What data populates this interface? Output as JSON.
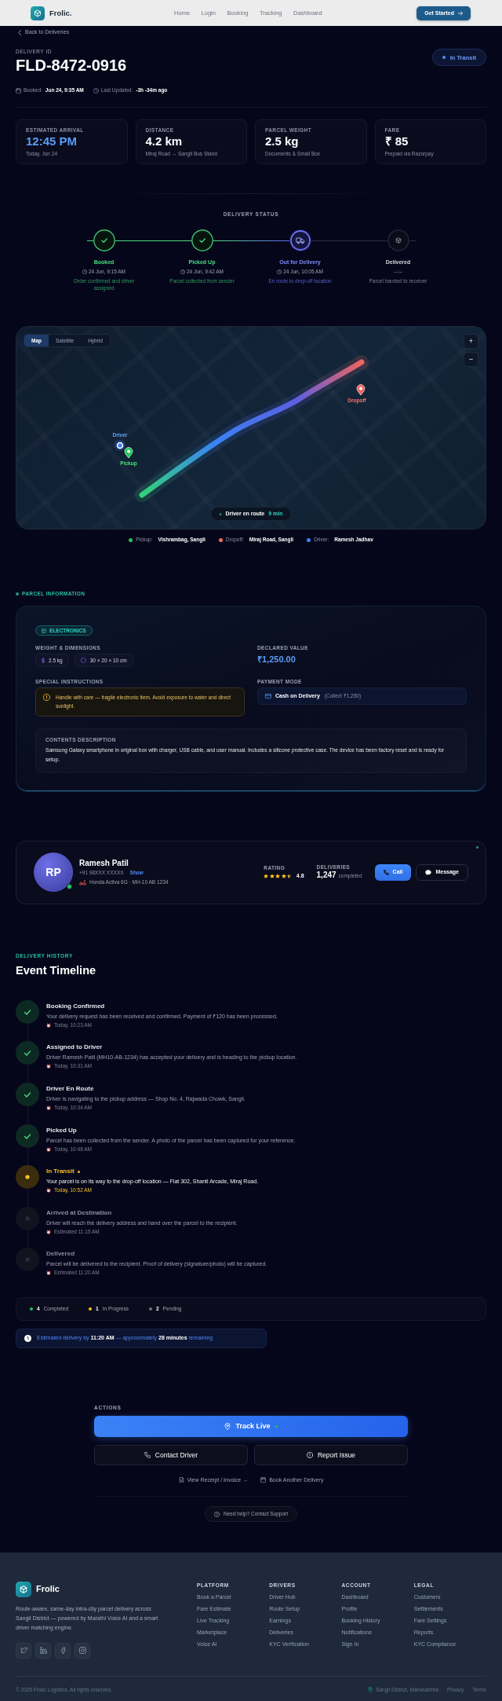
{
  "navbar": {
    "brand": "Frolic.",
    "links": [
      "Home",
      "Login",
      "Booking",
      "Tracking",
      "Dashboard"
    ],
    "cta": "Get Started"
  },
  "back_link": "Back to Deliveries",
  "header": {
    "id_label": "DELIVERY ID",
    "delivery_id": "FLD-8472-0916",
    "status": "In Transit",
    "booked_label": "Booked:",
    "booked_value": "Jun 24, 9:35 AM",
    "updated_label": "Last Updated:",
    "updated_value": "-3h -34m ago"
  },
  "stats": [
    {
      "label": "ESTIMATED ARRIVAL",
      "value": "12:45 PM",
      "detail": "Today, Jun 24",
      "highlight": true
    },
    {
      "label": "DISTANCE",
      "value": "4.2 km",
      "detail": "Miraj Road → Sangli Bus Stand",
      "highlight": false
    },
    {
      "label": "PARCEL WEIGHT",
      "value": "2.5 kg",
      "detail": "Documents & Small Box",
      "highlight": false
    },
    {
      "label": "FARE",
      "value": "₹ 85",
      "detail": "Prepaid via Razorpay",
      "highlight": false
    }
  ],
  "delivery_status": {
    "title": "DELIVERY STATUS",
    "steps": [
      {
        "label": "Booked",
        "time": "24 Jun, 9:15 AM",
        "note": "Order confirmed and driver assigned",
        "kind": "done"
      },
      {
        "label": "Picked Up",
        "time": "24 Jun, 9:42 AM",
        "note": "Parcel collected from sender",
        "kind": "done"
      },
      {
        "label": "Out for Delivery",
        "time": "24 Jun, 10:05 AM",
        "note": "En route to drop-off location",
        "kind": "current"
      },
      {
        "label": "Delivered",
        "time": "--:--",
        "note": "Parcel handed to receiver",
        "kind": "pending"
      }
    ]
  },
  "map": {
    "tabs": [
      {
        "label": "Map",
        "selected": true
      },
      {
        "label": "Satellite",
        "selected": false
      },
      {
        "label": "Hybrid",
        "selected": false
      }
    ],
    "zoom_in": "+",
    "zoom_out": "−",
    "markers": [
      {
        "kind": "driver",
        "label": "Driver"
      },
      {
        "kind": "pickup",
        "label": "Pickup"
      },
      {
        "kind": "dropoff",
        "label": "Dropoff"
      }
    ],
    "eta_label": "Driver en route",
    "eta_value": "9 min"
  },
  "legend": [
    {
      "label": "Pickup:",
      "value": "Vishrambag, Sangli",
      "color": "#22c55e"
    },
    {
      "label": "Dropoff:",
      "value": "Miraj Road, Sangli",
      "color": "#ef6b5f"
    },
    {
      "label": "Driver:",
      "value": "Ramesh Jadhav",
      "color": "#3b82f6"
    }
  ],
  "parcel": {
    "section_title": "PARCEL INFORMATION",
    "category": "ELECTRONICS",
    "weight_label": "WEIGHT & DIMENSIONS",
    "weight": "2.5 kg",
    "dimensions": "30 × 20 × 10 cm",
    "declared_label": "DECLARED VALUE",
    "declared_value": "₹1,250.00",
    "instructions_label": "SPECIAL INSTRUCTIONS",
    "instructions": "Handle with care — fragile electronic item. Avoid exposure to water and direct sunlight.",
    "payment_label": "PAYMENT MODE",
    "payment_mode": "Cash on Delivery",
    "payment_note": "(Collect ₹1,250)",
    "contents_label": "CONTENTS DESCRIPTION",
    "contents": "Samsung Galaxy smartphone in original box with charger, USB cable, and user manual. Includes a silicone protective case. The device has been factory reset and is ready for setup."
  },
  "driver": {
    "initials": "RP",
    "online": true,
    "name": "Ramesh Patil",
    "phone": "+91 98XXX XXXXX",
    "phone_action": "Show",
    "vehicle": "Honda Activa 6G · MH-10 AB 1234",
    "rating_label": "RATING",
    "stars": 4.5,
    "rating": "4.8",
    "deliveries_label": "DELIVERIES",
    "deliveries": "1,247",
    "deliveries_note": "completed",
    "call": "Call",
    "message": "Message"
  },
  "timeline": {
    "eyebrow": "DELIVERY HISTORY",
    "title": "Event Timeline",
    "events": [
      {
        "title": "Booking Confirmed",
        "description": "Your delivery request has been received and confirmed. Payment of ₹120 has been processed.",
        "time": "Today, 10:23 AM",
        "kind": "done"
      },
      {
        "title": "Assigned to Driver",
        "description": "Driver Ramesh Patil (MH10-AB-1234) has accepted your delivery and is heading to the pickup location.",
        "time": "Today, 10:31 AM",
        "kind": "done"
      },
      {
        "title": "Driver En Route",
        "description": "Driver is navigating to the pickup address — Shop No. 4, Rajwada Chowk, Sangli.",
        "time": "Today, 10:34 AM",
        "kind": "done"
      },
      {
        "title": "Picked Up",
        "description": "Parcel has been collected from the sender. A photo of the parcel has been captured for your reference.",
        "time": "Today, 10:48 AM",
        "kind": "done"
      },
      {
        "title": "In Transit",
        "description": "Your parcel is on its way to the drop-off location — Flat 302, Shanti Arcade, Miraj Road.",
        "time": "Today, 10:52 AM",
        "kind": "current"
      },
      {
        "title": "Arrived at Destination",
        "description": "Driver will reach the delivery address and hand over the parcel to the recipient.",
        "time": "Estimated 11:15 AM",
        "kind": "pending"
      },
      {
        "title": "Delivered",
        "description": "Parcel will be delivered to the recipient. Proof of delivery (signature/photo) will be captured.",
        "time": "Estimated 11:20 AM",
        "kind": "pending"
      }
    ]
  },
  "summary": [
    {
      "count": "4",
      "label": "Completed",
      "color": "#22c55e"
    },
    {
      "count": "1",
      "label": "In Progress",
      "color": "#fbbf24"
    },
    {
      "count": "2",
      "label": "Pending",
      "color": "#6b7280"
    }
  ],
  "eta_notice": "Estimated delivery by **11:20 AM** — approximately **28 minutes** remaining",
  "actions": {
    "title": "ACTIONS",
    "primary": "Track Live",
    "live": true,
    "buttons": [
      {
        "kind": "contact",
        "label": "Contact Driver"
      },
      {
        "kind": "report",
        "label": "Report Issue"
      }
    ],
    "links": [
      {
        "kind": "receipt",
        "label": "View Receipt / Invoice →"
      },
      {
        "kind": "book",
        "label": "Book Another Delivery"
      }
    ],
    "help": "Need help? Contact Support"
  },
  "footer": {
    "brand": "Frolic",
    "description": "Route-aware, same-day intra-city parcel delivery across Sangli District — powered by Marathi Voice AI and a smart driver matching engine.",
    "columns": [
      {
        "title": "PLATFORM",
        "links": [
          "Book a Parcel",
          "Fare Estimate",
          "Live Tracking",
          "Marketplace",
          "Voice AI"
        ]
      },
      {
        "title": "DRIVERS",
        "links": [
          "Driver Hub",
          "Route Setup",
          "Earnings",
          "Deliveries",
          "KYC Verification"
        ]
      },
      {
        "title": "ACCOUNT",
        "links": [
          "Dashboard",
          "Profile",
          "Booking History",
          "Notifications",
          "Sign In"
        ]
      },
      {
        "title": "LEGAL",
        "links": [
          "Customers",
          "Settlements",
          "Fare Settings",
          "Reports",
          "KYC Compliance"
        ]
      }
    ],
    "copyright": "© 2026 Frolic Logistics. All rights reserved.",
    "location": "Sangli District, Maharashtra",
    "links": [
      "Privacy",
      "Terms"
    ]
  }
}
